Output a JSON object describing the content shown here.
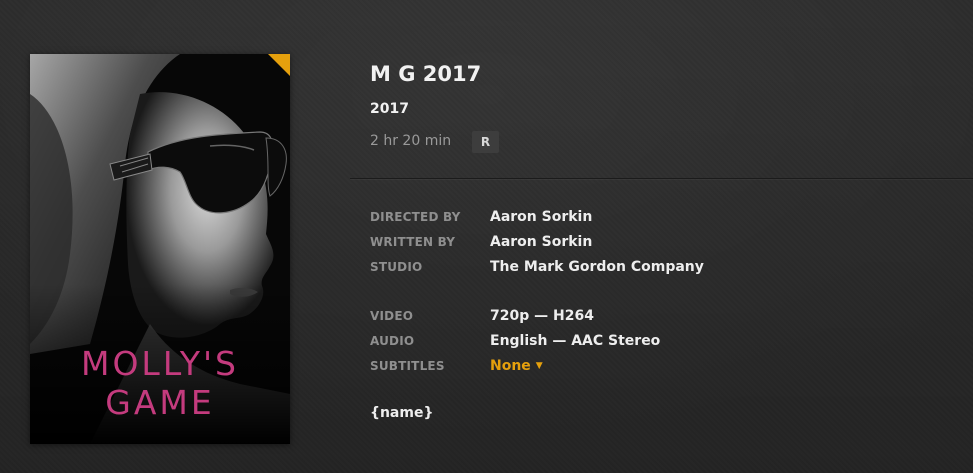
{
  "poster": {
    "title_line1": "MOLLY'S",
    "title_line2": "GAME",
    "corner_color": "#e5a00d",
    "title_color": "#c43b7e"
  },
  "header": {
    "title": "M G 2017",
    "year": "2017",
    "duration": "2 hr 20 min",
    "content_rating": "R"
  },
  "credits": [
    {
      "label": "DIRECTED BY",
      "value": "Aaron Sorkin"
    },
    {
      "label": "WRITTEN BY",
      "value": "Aaron Sorkin"
    },
    {
      "label": "STUDIO",
      "value": "The Mark Gordon Company"
    }
  ],
  "media": {
    "video_label": "VIDEO",
    "video_value": "720p — H264",
    "audio_label": "AUDIO",
    "audio_value": "English — AAC Stereo",
    "subtitles_label": "SUBTITLES",
    "subtitles_value": "None"
  },
  "summary": "{name}",
  "colors": {
    "background": "#2b2b2b",
    "accent": "#e5a00d",
    "label": "#8f8f8f",
    "muted": "#9a9a9a"
  }
}
